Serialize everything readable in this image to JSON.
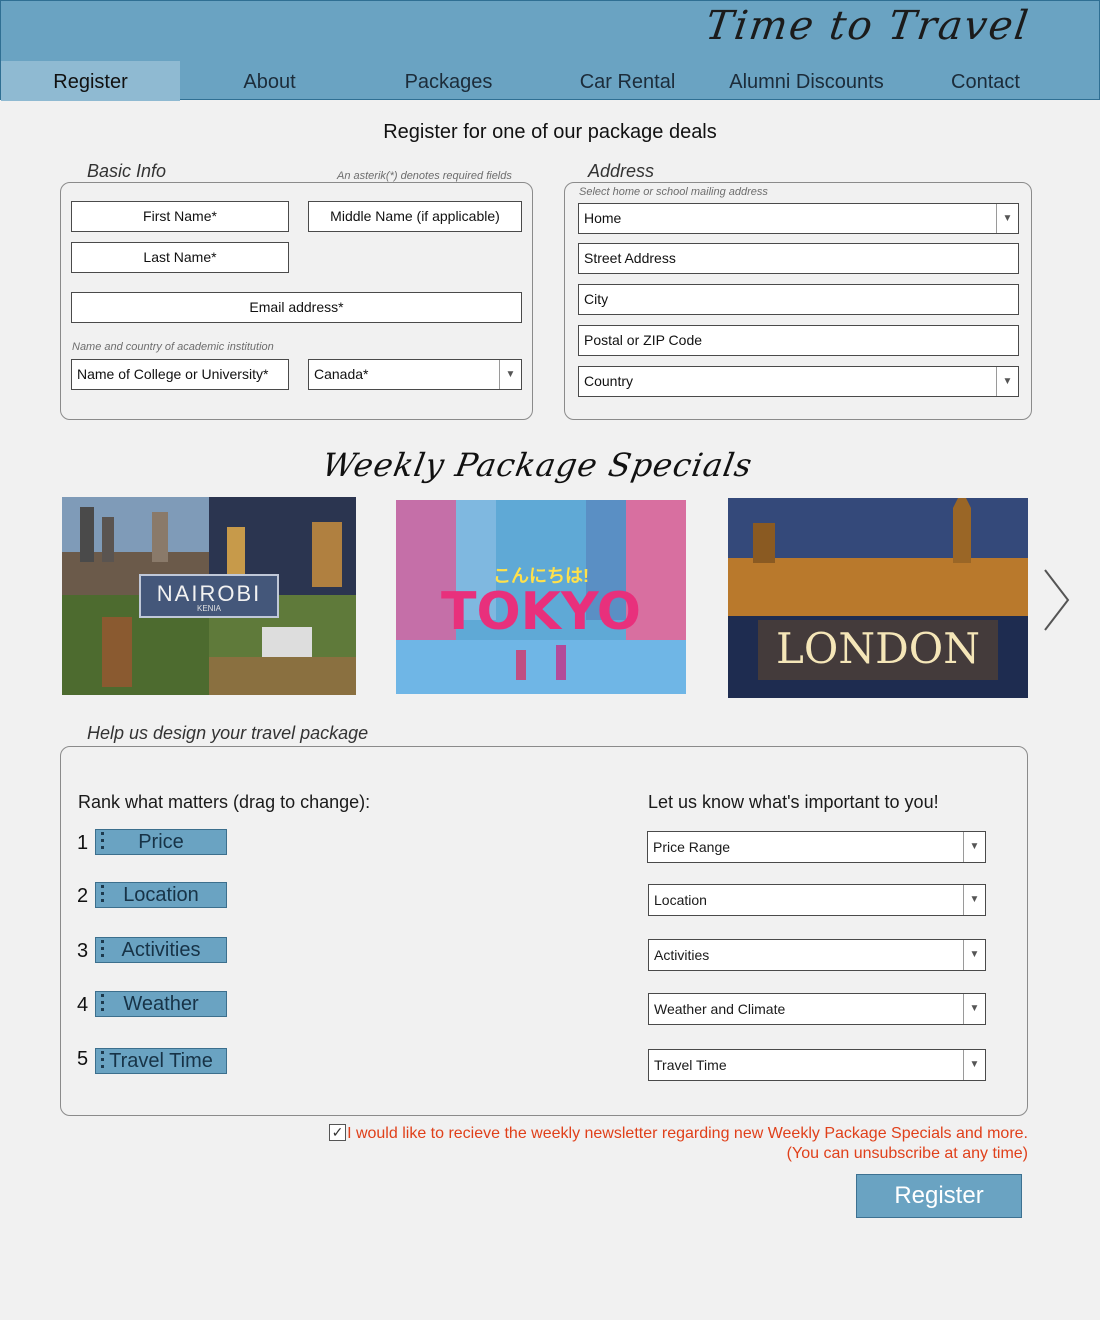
{
  "brand": "Time to Travel",
  "nav": [
    {
      "label": "Register",
      "active": true
    },
    {
      "label": "About"
    },
    {
      "label": "Packages"
    },
    {
      "label": "Car Rental"
    },
    {
      "label": "Alumni Discounts"
    },
    {
      "label": "Contact"
    }
  ],
  "page_title": "Register for one of our package deals",
  "basic_info": {
    "legend": "Basic Info",
    "hint": "An asterik(*) denotes required fields",
    "first_name": "First Name*",
    "middle_name": "Middle Name (if applicable)",
    "last_name": "Last Name*",
    "email": "Email address*",
    "institution_hint": "Name and country of academic institution",
    "institution": "Name of College or University*",
    "country": "Canada*"
  },
  "address": {
    "legend": "Address",
    "hint": "Select home or school mailing address",
    "type": "Home",
    "street": "Street Address",
    "city": "City",
    "postal": "Postal or ZIP Code",
    "country": "Country"
  },
  "specials": {
    "title": "Weekly Package Specials",
    "destinations": [
      {
        "name": "NAIROBI",
        "sub": "KENIA"
      },
      {
        "name": "TOKYO",
        "sub": "こんにちは!"
      },
      {
        "name": "LONDON"
      }
    ]
  },
  "design": {
    "legend": "Help us design your travel package",
    "rank_heading": "Rank what matters (drag to change):",
    "ranks": [
      {
        "num": "1",
        "label": "Price"
      },
      {
        "num": "2",
        "label": "Location"
      },
      {
        "num": "3",
        "label": "Activities"
      },
      {
        "num": "4",
        "label": "Weather"
      },
      {
        "num": "5",
        "label": "Travel Time"
      }
    ],
    "prefs_heading": "Let us know what's important to you!",
    "prefs": [
      "Price Range",
      "Location",
      "Activities",
      "Weather and Climate",
      "Travel Time"
    ]
  },
  "newsletter": {
    "checked": true,
    "line1": "I would like to recieve the weekly newsletter regarding new Weekly Package Specials and more.",
    "line2": "(You can unsubscribe at any time)"
  },
  "register_button": "Register",
  "colors": {
    "accent": "#6aa3c2",
    "warning": "#e0401a"
  }
}
